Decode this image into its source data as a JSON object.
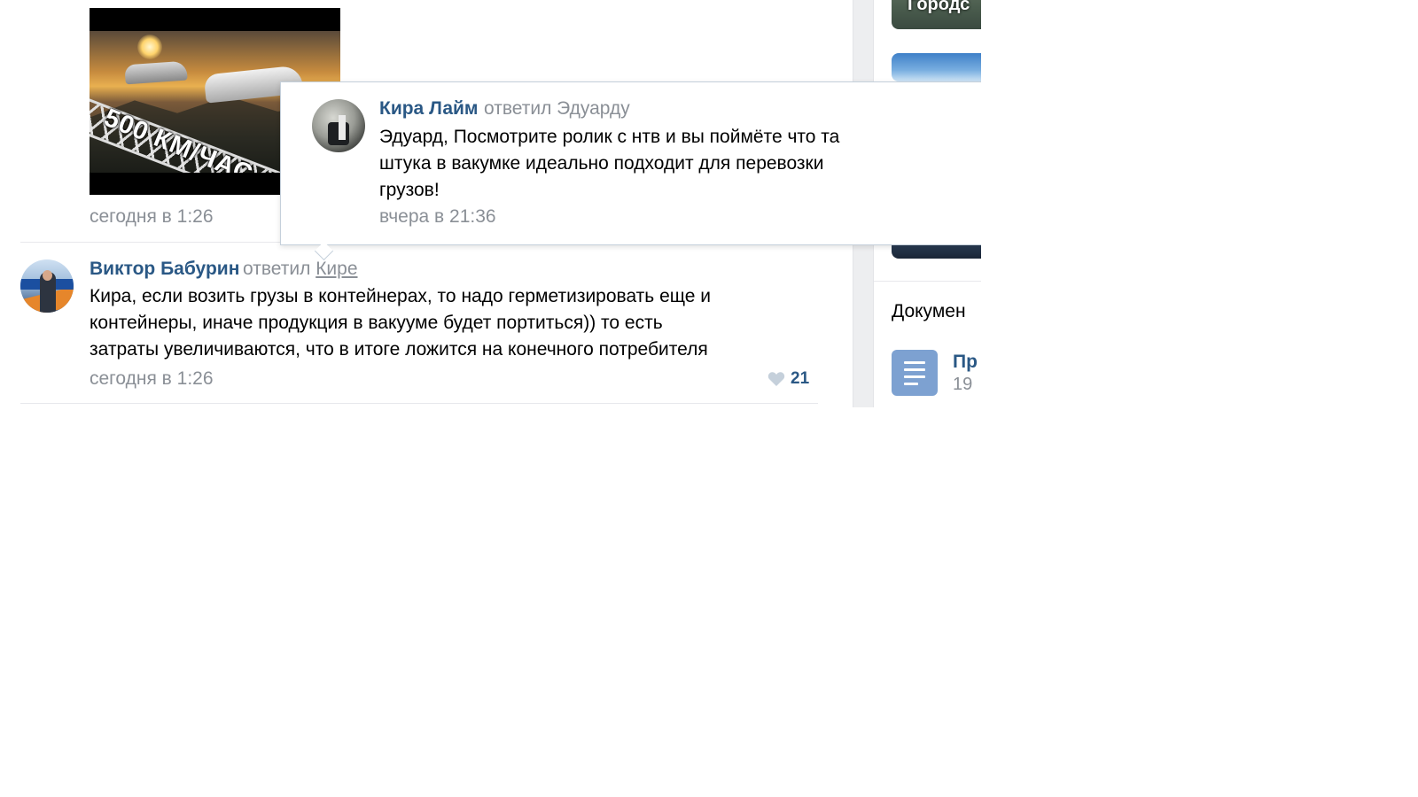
{
  "video": {
    "caption": "500 КМ/ЧАС",
    "date": "сегодня в 1:26"
  },
  "comment": {
    "author": "Виктор Бабурин",
    "reply_word": "ответил",
    "reply_target": "Кире",
    "lines": [
      "Кира, если возить грузы в контейнерах, то надо герметизировать еще и",
      "контейнеры, иначе продукция в вакууме будет портиться)) то есть",
      "затраты увеличиваются, что в итоге ложится на конечного потребителя"
    ],
    "date": "сегодня в 1:26",
    "likes": "21"
  },
  "popup": {
    "author": "Кира Лайм",
    "reply_text": "ответил Эдуарду",
    "lines": [
      "Эдуард, Посмотрите ролик с нтв и вы поймёте что та",
      "штука в вакумке идеально подходит для перевозки",
      "грузов!"
    ],
    "date": "вчера в 21:36"
  },
  "sidebar": {
    "city_label": "Городс",
    "documents_title": "Докумен",
    "doc_title": "Пр",
    "doc_meta": "19"
  },
  "colors": {
    "link": "#2a5885",
    "muted": "#8a8f96",
    "doc_icon": "#7da1d1"
  },
  "icons": [
    "heart-icon",
    "document-icon"
  ]
}
